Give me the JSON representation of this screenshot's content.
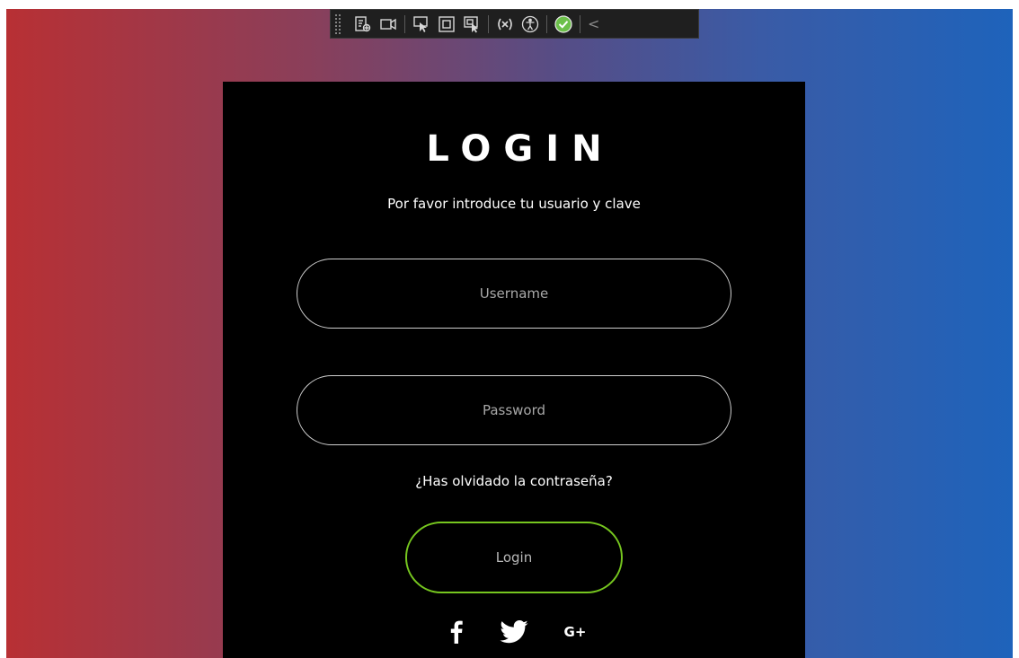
{
  "login": {
    "title": "LOGIN",
    "subtitle": "Por favor introduce tu usuario y clave",
    "username_placeholder": "Username",
    "password_placeholder": "Password",
    "forgot_label": "¿Has olvidado la contraseña?",
    "button_label": "Login",
    "social": {
      "google_label": "G+"
    }
  },
  "toolbar": {
    "icons": [
      "live-visual-tree-icon",
      "record-icon",
      "select-element-icon",
      "display-layout-adorners-icon",
      "track-focus-icon",
      "binding-failures-icon",
      "accessibility-icon",
      "checkmark-status-icon",
      "collapse-chevron-icon"
    ],
    "collapse_glyph": "<"
  },
  "colors": {
    "gradient_left": "#b83034",
    "gradient_right": "#1e63bb",
    "card_bg": "#000000",
    "field_border": "#cfcfcf",
    "login_border": "#76c61f",
    "check_green": "#6cc04a"
  }
}
